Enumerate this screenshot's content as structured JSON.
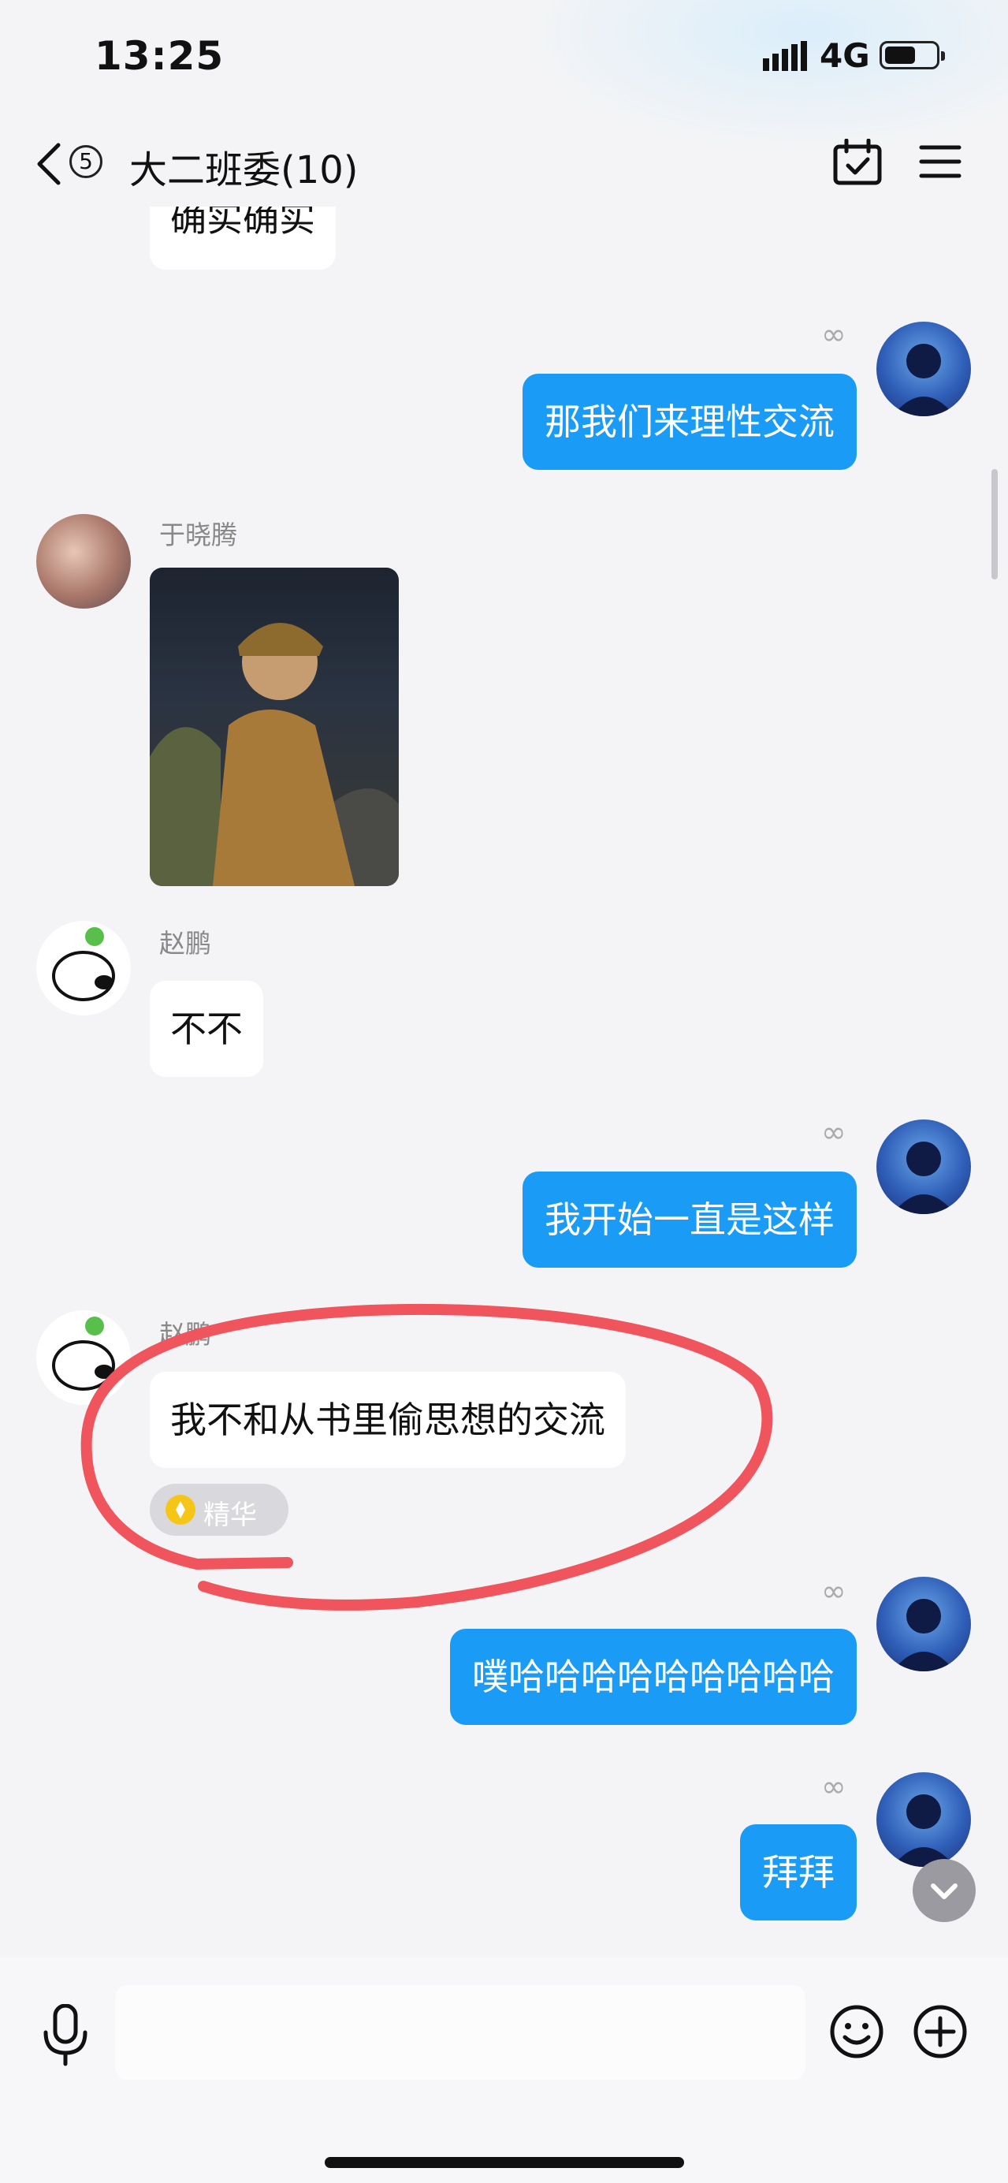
{
  "status_bar": {
    "time": "13:25",
    "network": "4G"
  },
  "header": {
    "unread_count": "5",
    "title": "大二班委(10)"
  },
  "messages": [
    {
      "side": "in",
      "text": "确实确实"
    },
    {
      "side": "out",
      "text": "那我们来理性交流"
    },
    {
      "side": "in",
      "sender": "于晓腾",
      "type": "image"
    },
    {
      "side": "in",
      "sender": "赵鹏",
      "text": "不不"
    },
    {
      "side": "out",
      "text": "我开始一直是这样"
    },
    {
      "side": "in",
      "sender": "赵鹏",
      "text": "我不和从书里偷思想的交流",
      "tag": "精华"
    },
    {
      "side": "out",
      "text": "噗哈哈哈哈哈哈哈哈哈"
    },
    {
      "side": "out",
      "text": "拜拜"
    }
  ],
  "colors": {
    "out_bubble": "#1a9bf6",
    "annotation": "#f0545c",
    "tag_icon": "#f5c518"
  },
  "icons": [
    "back-icon",
    "calendar-check-icon",
    "menu-icon",
    "loop-icon",
    "mic-icon",
    "emoji-icon",
    "plus-icon",
    "chevron-down-icon"
  ]
}
